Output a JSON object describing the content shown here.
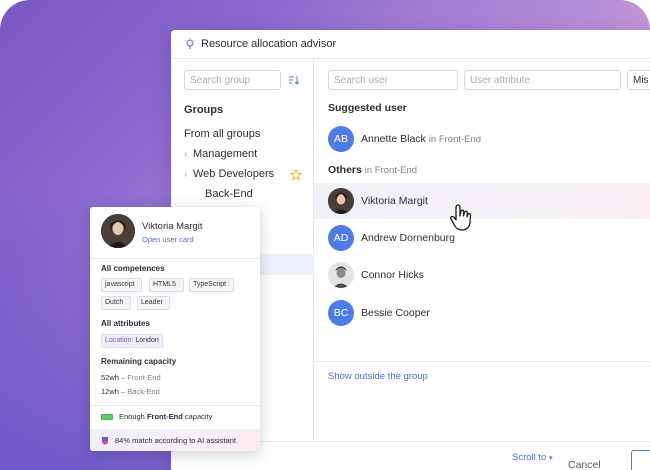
{
  "window": {
    "title": "Resource allocation advisor"
  },
  "left_panel": {
    "search_placeholder": "Search group",
    "heading": "Groups",
    "items": [
      {
        "label": "From all groups"
      },
      {
        "label": "Management",
        "expandable": true
      },
      {
        "label": "Web Developers",
        "expandable": true,
        "starred": true
      },
      {
        "label": "Back-End"
      }
    ]
  },
  "right_panel": {
    "search_user_placeholder": "Search user",
    "user_attribute_placeholder": "User attribute",
    "third_filter_value": "Mis",
    "suggested_heading": "Suggested user",
    "suggested": [
      {
        "initials": "AB",
        "name": "Annette Black",
        "team_prefix": "in",
        "team": "Front-End"
      }
    ],
    "others_heading": "Others",
    "others_sub": "in Front-End",
    "others": [
      {
        "name": "Viktoria Margit",
        "avatar": "photo",
        "hovered": true
      },
      {
        "name": "Andrew Dornenburg",
        "initials": "AD"
      },
      {
        "name": "Connor Hicks",
        "avatar": "photo"
      },
      {
        "name": "Bessie Cooper",
        "initials": "BC"
      }
    ],
    "show_outside": "Show outside the group",
    "scroll_to": "Scroll to",
    "scroll_to_icon": "caret-down-icon"
  },
  "footer": {
    "cancel": "Cancel"
  },
  "popup": {
    "name": "Viktoria Margit",
    "open_card": "Open user card",
    "competences_heading": "All competences",
    "competences": [
      "javascript",
      "HTML5",
      "TypeScript",
      "Dutch",
      "Leader"
    ],
    "attributes_heading": "All attributes",
    "attribute": {
      "key": "Location:",
      "value": "London"
    },
    "capacity_heading": "Remaining capacity",
    "capacity": [
      {
        "amount": "52wh",
        "sep": "–",
        "team": "Front-End"
      },
      {
        "amount": "12wh",
        "sep": "–",
        "team": "Back-End"
      }
    ],
    "enough_prefix": "Enough",
    "enough_team": "Front-End",
    "enough_suffix": "capacity",
    "match": "84% match according to AI assistant"
  },
  "colors": {
    "accent": "#4f7be6",
    "link": "#4a6fd8",
    "gradient_start": "#7b57c4",
    "gradient_end": "#f7c6d4"
  }
}
